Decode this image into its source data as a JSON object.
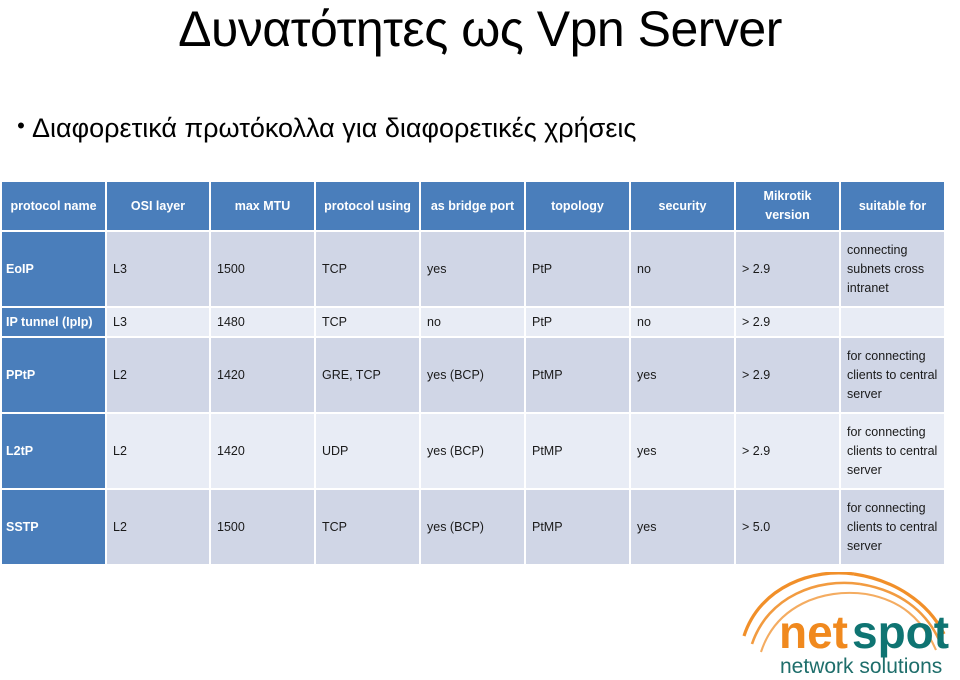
{
  "slide": {
    "title": "Δυνατότητες ως Vpn Server",
    "bullet": {
      "marker": "•",
      "text": "Διαφορετικά πρωτόκολλα για διαφορετικές χρήσεις"
    }
  },
  "table": {
    "headers": [
      "protocol name",
      "OSI layer",
      "max MTU",
      "protocol using",
      "as bridge port",
      "topology",
      "security",
      "Mikrotik version",
      "suitable for"
    ],
    "rows": [
      {
        "name": "EoIP",
        "osi_layer": "L3",
        "max_mtu": "1500",
        "protocol_using": "TCP",
        "as_bridge_port": "yes",
        "topology": "PtP",
        "security": "no",
        "mikrotik_version": "> 2.9",
        "suitable_for": "connecting subnets cross intranet"
      },
      {
        "name": "IP tunnel (IpIp)",
        "osi_layer": "L3",
        "max_mtu": "1480",
        "protocol_using": "TCP",
        "as_bridge_port": "no",
        "topology": "PtP",
        "security": "no",
        "mikrotik_version": "> 2.9",
        "suitable_for": ""
      },
      {
        "name": "PPtP",
        "osi_layer": "L2",
        "max_mtu": "1420",
        "protocol_using": "GRE, TCP",
        "as_bridge_port": "yes (BCP)",
        "topology": "PtMP",
        "security": "yes",
        "mikrotik_version": "> 2.9",
        "suitable_for": "for connecting clients to central server"
      },
      {
        "name": "L2tP",
        "osi_layer": "L2",
        "max_mtu": "1420",
        "protocol_using": "UDP",
        "as_bridge_port": "yes (BCP)",
        "topology": "PtMP",
        "security": "yes",
        "mikrotik_version": "> 2.9",
        "suitable_for": "for connecting clients to central server"
      },
      {
        "name": "SSTP",
        "osi_layer": "L2",
        "max_mtu": "1500",
        "protocol_using": "TCP",
        "as_bridge_port": "yes (BCP)",
        "topology": "PtMP",
        "security": "yes",
        "mikrotik_version": "> 5.0",
        "suitable_for": "for connecting clients to central server"
      }
    ]
  },
  "logo": {
    "word_first": "net",
    "word_second": "spot",
    "tagline": "network solutions",
    "colors": {
      "orange": "#F0891E",
      "teal": "#0F7472",
      "arc": "#F0891E",
      "tagline": "#1E6E6B",
      "header_blue": "#4A7EBB",
      "row_dark": "#D0D6E6",
      "row_light": "#E8ECF5"
    }
  }
}
